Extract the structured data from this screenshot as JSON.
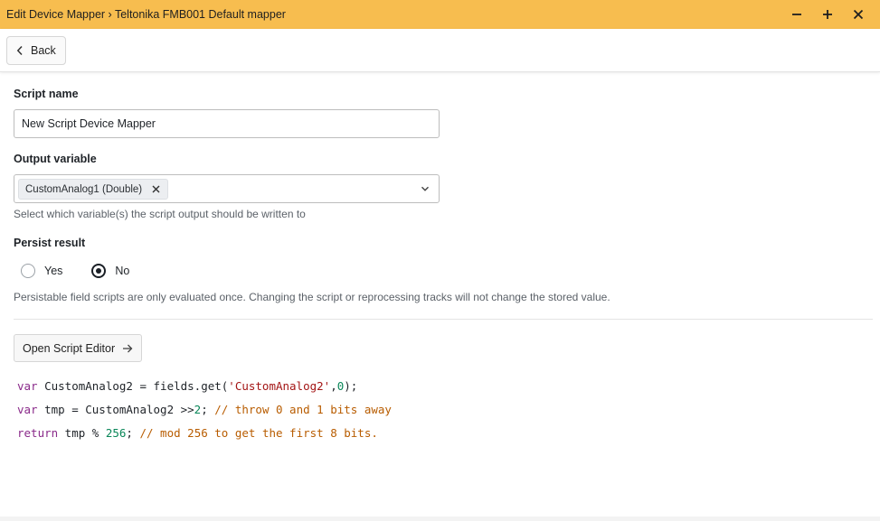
{
  "window": {
    "title": "Edit Device Mapper › Teltonika FMB001 Default mapper",
    "controls": [
      "minimize-icon",
      "maximize-icon",
      "close-icon"
    ]
  },
  "toolbar": {
    "back_label": "Back"
  },
  "form": {
    "script_name": {
      "label": "Script name",
      "value": "New Script Device Mapper"
    },
    "output_variable": {
      "label": "Output variable",
      "selected_chip": "CustomAnalog1 (Double)",
      "help": "Select which variable(s) the script output should be written to"
    },
    "persist_result": {
      "label": "Persist result",
      "options": [
        "Yes",
        "No"
      ],
      "selected": "No",
      "help": "Persistable field scripts are only evaluated once. Changing the script or reprocessing tracks will not change the stored value."
    },
    "open_editor_label": "Open Script Editor"
  },
  "code": {
    "line1": {
      "kw": "var",
      "a": " CustomAnalog2 = fields.get(",
      "str": "'CustomAnalog2'",
      "b": ",",
      "num": "0",
      "c": ");"
    },
    "line2": {
      "kw": "var",
      "a": " tmp = CustomAnalog2 >>",
      "num": "2",
      "b": "; ",
      "cmt": "// throw 0 and 1 bits away"
    },
    "line3": {
      "kw": "return",
      "a": " tmp % ",
      "num": "256",
      "b": "; ",
      "cmt": "// mod 256 to get the first 8 bits."
    }
  },
  "colors": {
    "titlebar": "#f7bd4f",
    "keyword": "#8a2a8a",
    "string": "#a31515",
    "number": "#098658",
    "comment": "#b85c00"
  }
}
